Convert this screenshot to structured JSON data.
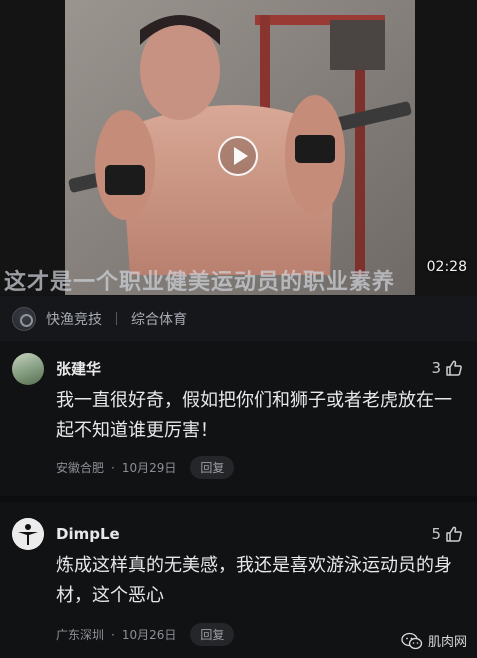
{
  "video": {
    "duration": "02:28",
    "caption": "这才是一个职业健美运动员的职业素养"
  },
  "source": {
    "name": "快渔竞技",
    "tag": "综合体育"
  },
  "comments": [
    {
      "username": "张建华",
      "likes": "3",
      "text": "我一直很好奇，假如把你们和狮子或者老虎放在一起不知道谁更厉害！",
      "location": "安徽合肥",
      "date": "10月29日",
      "reply_label": "回复"
    },
    {
      "username": "DimpLe",
      "likes": "5",
      "text": "炼成这样真的无美感，我还是喜欢游泳运动员的身材，这个恶心",
      "location": "广东深圳",
      "date": "10月26日",
      "reply_label": "回复"
    }
  ],
  "watermark": {
    "text": "肌肉网"
  },
  "icons": {
    "play": "play-icon",
    "like": "thumb-up-icon",
    "wechat": "wechat-icon"
  },
  "colors": {
    "background": "#111214",
    "text": "#e8e8e8",
    "meta": "#8c8f96"
  }
}
